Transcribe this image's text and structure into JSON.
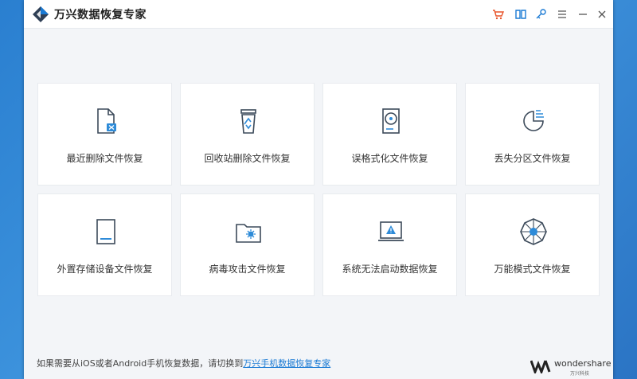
{
  "app": {
    "title": "万兴数据恢复专家"
  },
  "toolbar": {
    "buttons": [
      {
        "name": "cart-icon",
        "color": "#e8542a"
      },
      {
        "name": "guide-book-icon",
        "color": "#1a7ad4"
      },
      {
        "name": "key-icon",
        "color": "#1a7ad4"
      },
      {
        "name": "menu-icon",
        "color": "#555555"
      },
      {
        "name": "minimize-icon",
        "color": "#555555"
      },
      {
        "name": "close-icon",
        "color": "#555555"
      }
    ]
  },
  "modes": [
    {
      "label": "最近删除文件恢复",
      "icon": "recent-deleted-file-icon"
    },
    {
      "label": "回收站删除文件恢复",
      "icon": "recycle-bin-icon"
    },
    {
      "label": "误格式化文件恢复",
      "icon": "formatted-drive-icon"
    },
    {
      "label": "丢失分区文件恢复",
      "icon": "lost-partition-icon"
    },
    {
      "label": "外置存储设备文件恢复",
      "icon": "external-device-icon"
    },
    {
      "label": "病毒攻击文件恢复",
      "icon": "virus-folder-icon"
    },
    {
      "label": "系统无法启动数据恢复",
      "icon": "crashed-system-icon"
    },
    {
      "label": "万能模式文件恢复",
      "icon": "all-round-icon"
    }
  ],
  "footer": {
    "note": "如果需要从iOS或者Android手机恢复数据，请切换到",
    "link": "万兴手机数据恢复专家",
    "brand_name": "wondershare",
    "brand_sub": "万兴科技"
  },
  "colors": {
    "accent": "#1a7ad4",
    "icon_dark": "#3c4a5a",
    "icon_blue": "#2e8bd8"
  }
}
